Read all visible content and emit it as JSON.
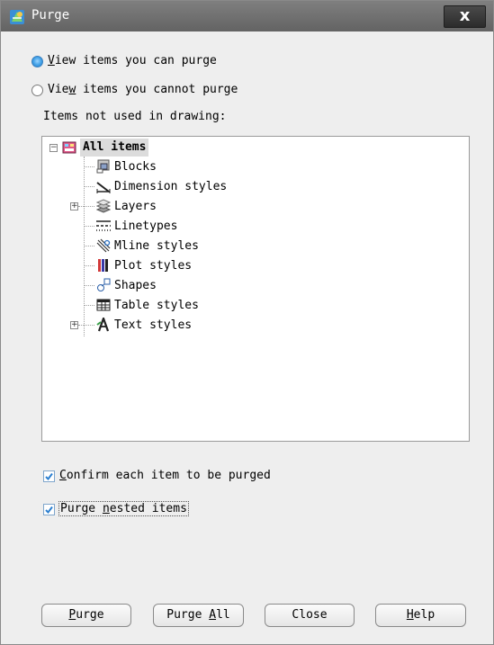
{
  "window": {
    "title": "Purge",
    "close_glyph": "x"
  },
  "options": {
    "view_can_purge": {
      "prefix": "",
      "mnemonic": "V",
      "rest": "iew items you can purge",
      "selected": true
    },
    "view_cannot_purge": {
      "prefix": "Vie",
      "mnemonic": "w",
      "rest": " items you cannot purge",
      "selected": false
    }
  },
  "tree_heading": "Items not used in drawing:",
  "tree": {
    "root": {
      "label": "All items",
      "expander": "−"
    },
    "items": [
      {
        "label": "Blocks",
        "icon": "blocks-icon",
        "expandable": false
      },
      {
        "label": "Dimension styles",
        "icon": "dimension-styles-icon",
        "expandable": false
      },
      {
        "label": "Layers",
        "icon": "layers-icon",
        "expandable": true,
        "expander": "+"
      },
      {
        "label": "Linetypes",
        "icon": "linetypes-icon",
        "expandable": false
      },
      {
        "label": "Mline styles",
        "icon": "mline-styles-icon",
        "expandable": false
      },
      {
        "label": "Plot styles",
        "icon": "plot-styles-icon",
        "expandable": false
      },
      {
        "label": "Shapes",
        "icon": "shapes-icon",
        "expandable": false
      },
      {
        "label": "Table styles",
        "icon": "table-styles-icon",
        "expandable": false
      },
      {
        "label": "Text styles",
        "icon": "text-styles-icon",
        "expandable": true,
        "expander": "+"
      }
    ]
  },
  "checkboxes": {
    "confirm": {
      "mnemonic": "C",
      "rest": "onfirm each item to be purged",
      "checked": true
    },
    "nested": {
      "prefix": "Purge ",
      "mnemonic": "n",
      "rest": "ested items",
      "checked": true
    }
  },
  "buttons": {
    "purge": {
      "mnemonic": "P",
      "rest": "urge"
    },
    "purge_all": {
      "prefix": "Purge ",
      "mnemonic": "A",
      "rest": "ll"
    },
    "close": {
      "label": "Close"
    },
    "help": {
      "mnemonic": "H",
      "rest": "elp"
    }
  },
  "colors": {
    "titlebar": "#6f6f6f",
    "dialog_bg": "#eeeeee",
    "radio_selected": "#3f9fe6",
    "check_mark": "#2b7fd0"
  }
}
